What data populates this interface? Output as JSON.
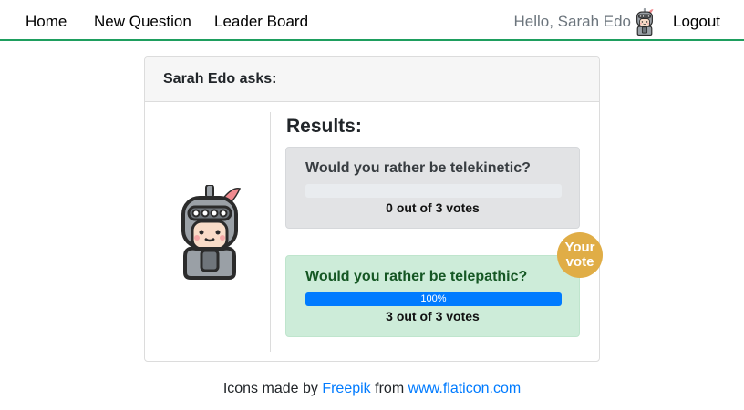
{
  "nav": {
    "home": "Home",
    "new_question": "New Question",
    "leader_board": "Leader Board",
    "greeting": "Hello, Sarah Edo",
    "logout": "Logout"
  },
  "card": {
    "header": "Sarah Edo asks:",
    "results_title": "Results:",
    "options": [
      {
        "text": "Would you rather be telekinetic?",
        "votes_text": "0 out of 3 votes",
        "percent": 0,
        "percent_label": ""
      },
      {
        "text": "Would you rather be telepathic?",
        "votes_text": "3 out of 3 votes",
        "percent": 100,
        "percent_label": "100%"
      }
    ],
    "your_vote_line1": "Your",
    "your_vote_line2": "vote"
  },
  "footer": {
    "prefix": "Icons made by",
    "author": "Freepik",
    "middle": "from",
    "site": "www.flaticon.com"
  },
  "colors": {
    "nav_underline": "#1e9e5e",
    "progress_fill": "#007bff",
    "badge": "#e0ad46",
    "selected_option_bg": "#cdecd9",
    "option_bg": "#e2e3e5"
  },
  "icons": {
    "user_avatar": "knight-avatar-icon"
  }
}
